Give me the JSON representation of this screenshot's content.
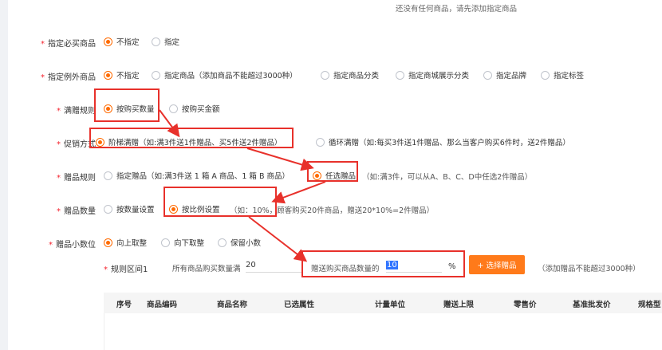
{
  "notice": "还没有任何商品，请先添加指定商品",
  "rows": {
    "must_buy": {
      "label": "指定必买商品",
      "options": [
        "不指定",
        "指定"
      ]
    },
    "exclude": {
      "label": "指定例外商品",
      "options": [
        "不指定",
        "指定商品（添加商品不能超过3000种）",
        "指定商品分类",
        "指定商城展示分类",
        "指定品牌",
        "指定标签"
      ]
    },
    "gift_rule": {
      "label": "满赠规则",
      "options": [
        "按购买数量",
        "按购买金额"
      ]
    },
    "promo_type": {
      "label": "促销方式",
      "options": [
        "阶梯满赠（如:满3件送1件赠品、买5件送2件赠品）",
        "循环满赠（如:每买3件送1件赠品、那么当客户购买6件时，送2件赠品）"
      ]
    },
    "gift_mode": {
      "label": "赠品规则",
      "options": [
        "指定赠品（如:满3件送 1 箱 A 商品、1 箱 B 商品）",
        "任选赠品",
        "（如:满3件，可以从A、B、C、D中任选2件赠品）"
      ]
    },
    "gift_qty": {
      "label": "赠品数量",
      "options": [
        "按数量设置",
        "按比例设置",
        "（如：10%，顾客购买20件商品，赠送20*10%=2件赠品）"
      ]
    },
    "decimal": {
      "label": "赠品小数位",
      "options": [
        "向上取整",
        "向下取整",
        "保留小数"
      ]
    }
  },
  "range": {
    "label": "规则区间1",
    "buy_label": "所有商品购买数量满",
    "buy_value": "20",
    "give_label": "赠送购买商品数量的",
    "give_value": "10",
    "percent": "%",
    "add_button": "+ 选择赠品",
    "hint": "（添加赠品不能超过3000种）"
  },
  "table": {
    "headers": [
      "序号",
      "商品编码",
      "商品名称",
      "已选属性",
      "计量单位",
      "赠送上限",
      "零售价",
      "基准批发价",
      "规格型"
    ]
  },
  "colors": {
    "accent": "#ff6a00",
    "highlight": "#e8312b",
    "button": "#ff7a1a",
    "selection": "#2f74ff"
  }
}
